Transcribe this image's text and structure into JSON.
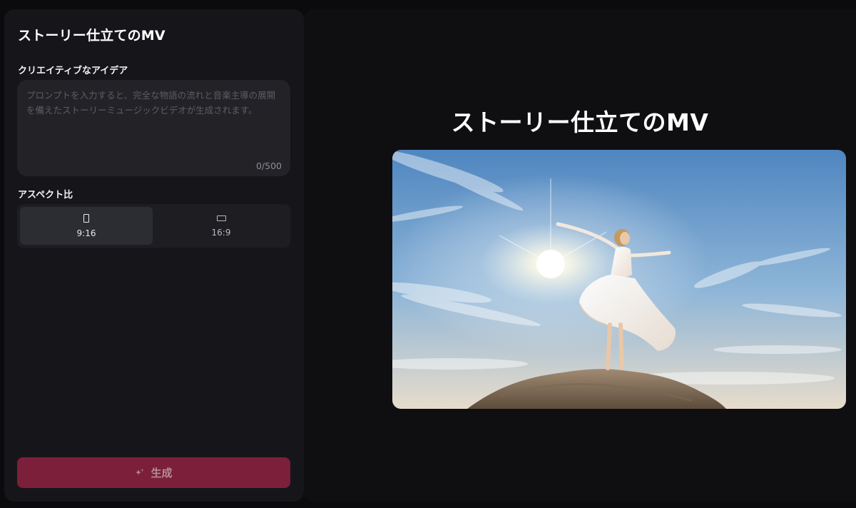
{
  "panel": {
    "title": "ストーリー仕立てのMV",
    "idea_label": "クリエイティブなアイデア",
    "prompt": {
      "value": "",
      "placeholder": "プロンプトを入力すると、完全な物語の流れと音楽主導の展開を備えたストーリーミュージックビデオが生成されます。",
      "char_count": "0/500"
    },
    "aspect_label": "アスペクト比",
    "aspect_options": [
      {
        "label": "9:16",
        "icon": "portrait-icon",
        "selected": true
      },
      {
        "label": "16:9",
        "icon": "landscape-icon",
        "selected": false
      }
    ],
    "generate_label": "生成",
    "generate_icon": "sparkle-icon"
  },
  "preview": {
    "title": "ストーリー仕立てのMV",
    "image_icon": "sample-preview-image"
  },
  "colors": {
    "accent": "#7c1f3b",
    "panel_bg": "#16161a",
    "page_bg": "#0b0b0d"
  }
}
